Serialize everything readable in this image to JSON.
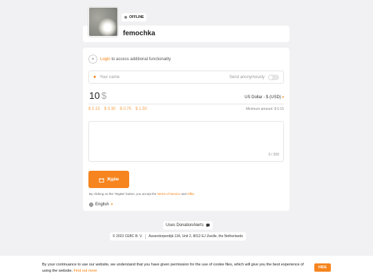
{
  "profile": {
    "status": "OFFLINE",
    "username": "femochka"
  },
  "login": {
    "link_text": "Login",
    "rest_text": "to access additional functionality"
  },
  "name_field": {
    "placeholder": "Your name",
    "anonymous_label": "Send anonymously"
  },
  "donation": {
    "amount": "10",
    "currency_symbol": "$",
    "currency_select": "US Dollar - $ (USD)",
    "presets": [
      "$ 0.15",
      "$ 0.30",
      "$ 0.75",
      "$ 1.50"
    ],
    "minimum": "Minimum amount: $ 0.15",
    "message_count": "0 / 200"
  },
  "send_button": {
    "label": "Ждём"
  },
  "terms": {
    "prefix": "By clicking on the \"Ждём\" button, you accept the",
    "terms_link": "Terms of Service",
    "and": "and",
    "offer_link": "Offer."
  },
  "language": {
    "selected": "English"
  },
  "footer": {
    "uses": "Uses DonationAlerts",
    "copyright": "© 2023 CEBC B. V.",
    "address": "Assendorperdijk 134, Unit 2, 8012 EJ Zwolle, the Netherlands"
  },
  "cookie": {
    "text": "By your continuance to use our website, we understand that you have given permission for the use of cookie files, which will give you the best experience of using the website.",
    "link": "Find out more",
    "hide_label": "HIDE"
  },
  "icons": {
    "person": "person-icon",
    "gift": "gift-icon",
    "globe": "globe-icon",
    "chat": "chat-icon",
    "chevron": "chevron-down-icon"
  },
  "colors": {
    "accent": "#f6851f",
    "background": "#f1f1f3"
  }
}
